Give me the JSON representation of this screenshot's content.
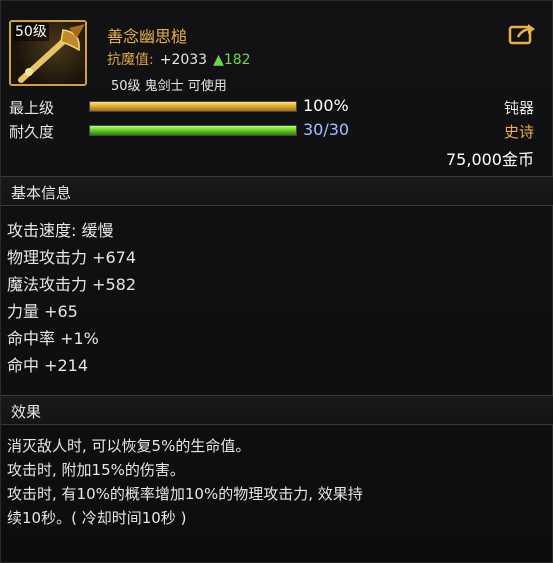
{
  "item": {
    "level_badge": "50级",
    "name": "善念幽思槌",
    "stat_label": "抗魔值:",
    "stat_value": "+2033",
    "stat_up": "▲182",
    "requirement": "50级 鬼剑士 可使用"
  },
  "bars": [
    {
      "label": "最上级",
      "value_text": "100%",
      "fill": 1.0,
      "right_text": "钝器",
      "right_color": "#e6e6e6",
      "value_color": "#ffffff",
      "style": "gold"
    },
    {
      "label": "耐久度",
      "value_text": "30/30",
      "fill": 1.0,
      "right_text": "史诗",
      "right_color": "#e6b14a",
      "value_color": "#9fc2ff",
      "style": "green"
    }
  ],
  "price": "75,000金币",
  "basic_info": {
    "title": "基本信息",
    "rows": [
      "攻击速度: 缓慢",
      "物理攻击力 +674",
      "魔法攻击力 +582",
      "力量 +65",
      "命中率 +1%",
      "命中 +214"
    ]
  },
  "effects": {
    "title": "效果",
    "rows": [
      "消灭敌人时, 可以恢复5%的生命值。",
      "攻击时, 附加15%的伤害。",
      "攻击时, 有10%的概率增加10%的物理攻击力, 效果持",
      "续10秒。( 冷却时间10秒 )"
    ]
  },
  "icons": {
    "share": "share-icon",
    "weapon": "weapon-icon"
  },
  "colors": {
    "gold": "#e6b14a",
    "green_up": "#6dd64a",
    "epic": "#e6b14a",
    "durability": "#9fc2ff"
  }
}
